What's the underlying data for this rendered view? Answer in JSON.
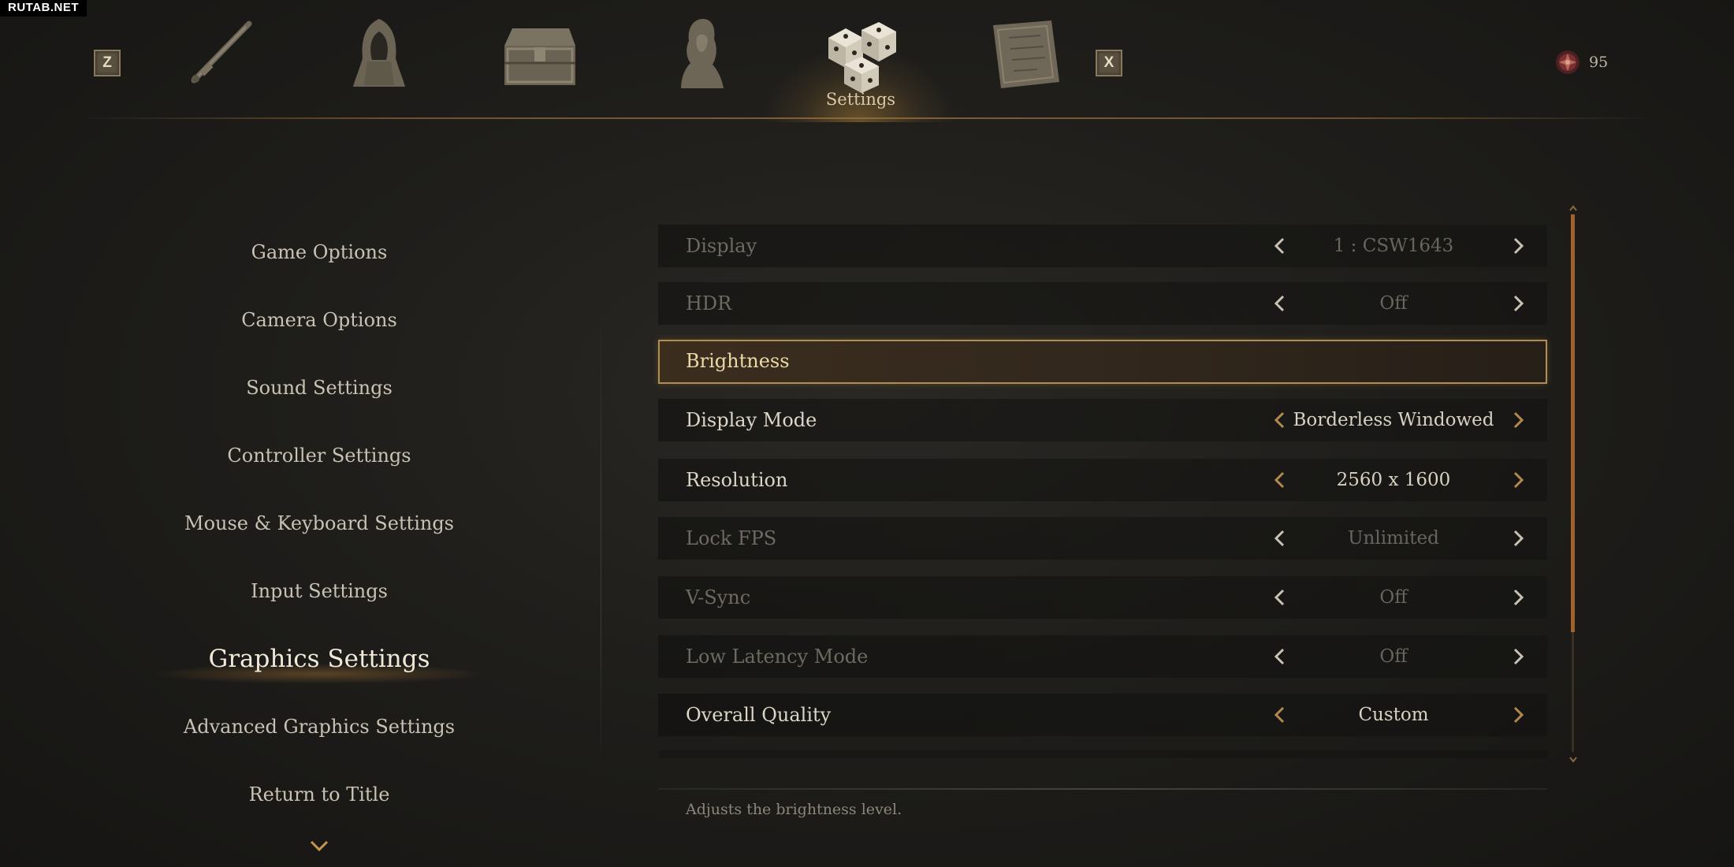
{
  "watermark": "RUTAB.NET",
  "topbar": {
    "prev_key": "Z",
    "next_key": "X",
    "tabs": [
      {
        "icon": "sword-icon"
      },
      {
        "icon": "hooded-figure-icon"
      },
      {
        "icon": "treasure-chest-icon"
      },
      {
        "icon": "character-portrait-icon"
      },
      {
        "icon": "settings-dice-icon",
        "label": "Settings",
        "active": true
      },
      {
        "icon": "map-scroll-icon"
      }
    ],
    "currency_icon": "gem-icon",
    "currency_value": "95"
  },
  "menu": {
    "items": [
      {
        "label": "Game Options"
      },
      {
        "label": "Camera Options"
      },
      {
        "label": "Sound Settings"
      },
      {
        "label": "Controller Settings"
      },
      {
        "label": "Mouse & Keyboard Settings"
      },
      {
        "label": "Input Settings"
      },
      {
        "label": "Graphics Settings",
        "active": true
      },
      {
        "label": "Advanced Graphics Settings"
      },
      {
        "label": "Return to Title"
      }
    ],
    "more_icon": "chevron-down-icon"
  },
  "settings": {
    "rows": [
      {
        "label": "Display",
        "value": "1 : CSW1643",
        "enabled": false
      },
      {
        "label": "HDR",
        "value": "Off",
        "enabled": false
      },
      {
        "label": "Brightness",
        "value": "",
        "selected": true
      },
      {
        "label": "Display Mode",
        "value": "Borderless Windowed",
        "enabled": true
      },
      {
        "label": "Resolution",
        "value": "2560 x 1600",
        "enabled": true
      },
      {
        "label": "Lock FPS",
        "value": "Unlimited",
        "enabled": false
      },
      {
        "label": "V-Sync",
        "value": "Off",
        "enabled": false
      },
      {
        "label": "Low Latency Mode",
        "value": "Off",
        "enabled": false
      },
      {
        "label": "Overall Quality",
        "value": "Custom",
        "enabled": true
      }
    ],
    "description": "Adjusts the brightness level."
  },
  "colors": {
    "accent": "#b08d52",
    "scroll_thumb": "#a0622a",
    "text_enabled": "#ddd6c8",
    "text_disabled": "#6f6a61"
  }
}
